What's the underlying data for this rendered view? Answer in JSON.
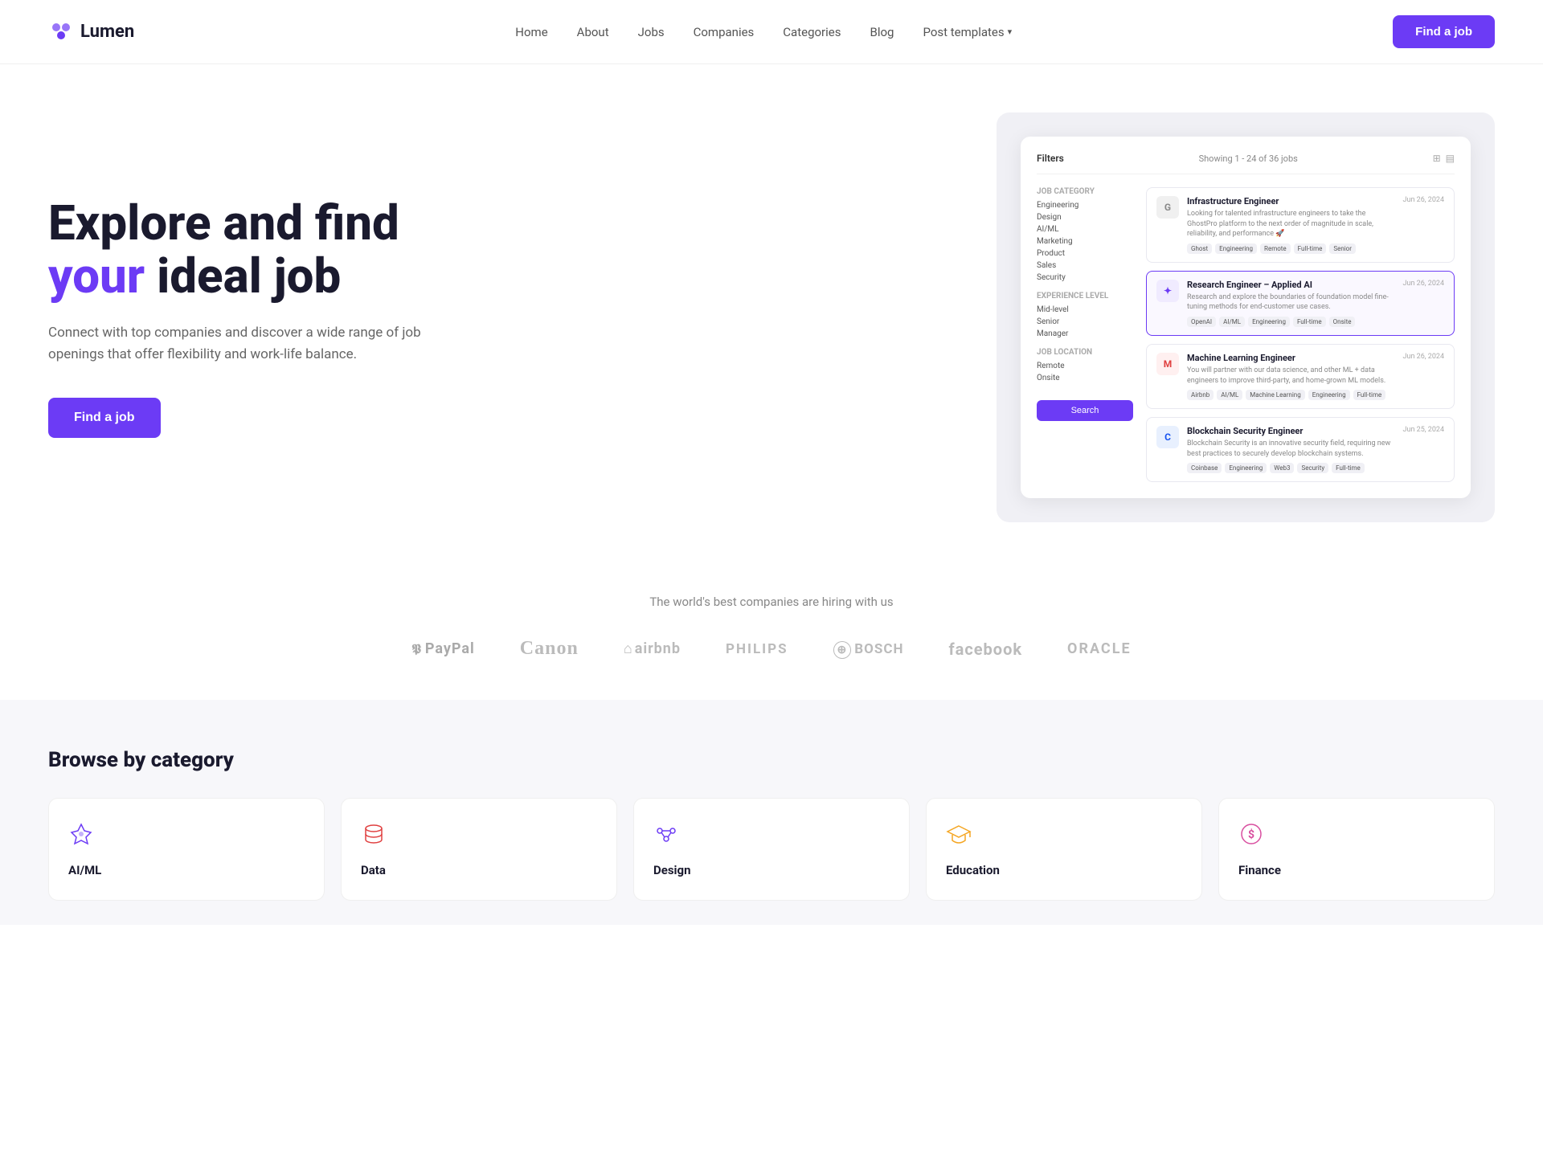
{
  "navbar": {
    "logo_text": "Lumen",
    "nav_items": [
      {
        "label": "Home",
        "id": "home"
      },
      {
        "label": "About",
        "id": "about"
      },
      {
        "label": "Jobs",
        "id": "jobs"
      },
      {
        "label": "Companies",
        "id": "companies"
      },
      {
        "label": "Categories",
        "id": "categories"
      },
      {
        "label": "Blog",
        "id": "blog"
      },
      {
        "label": "Post templates",
        "id": "post-templates",
        "has_dropdown": true
      }
    ],
    "cta_label": "Find a job"
  },
  "hero": {
    "title_line1": "Explore and find",
    "title_highlight": "your",
    "title_line2": "ideal job",
    "subtitle": "Connect with top companies and discover a wide range of job openings that offer flexibility and work-life balance.",
    "cta_label": "Find a job"
  },
  "mock_ui": {
    "filters_label": "Filters",
    "showing_text": "Showing 1 - 24 of 36 jobs",
    "sidebar": {
      "sections": [
        {
          "title": "Job category",
          "items": [
            "Engineering",
            "Design",
            "AI/ML",
            "Marketing",
            "Product",
            "Sales",
            "Security"
          ]
        },
        {
          "title": "Experience Level",
          "items": [
            "Mid-level",
            "Senior",
            "Manager"
          ]
        },
        {
          "title": "Job location",
          "items": [
            "Remote",
            "Onsite"
          ]
        }
      ],
      "search_btn": "Search"
    },
    "jobs": [
      {
        "title": "Infrastructure Engineer",
        "logo": "G",
        "logo_color": "#888",
        "date": "Jun 26, 2024",
        "description": "Looking for talented infrastructure engineers to take the GhostPro platform to the next order of magnitude in scale, reliability, and performance 🚀",
        "tags": [
          "Ghost",
          "Engineering",
          "Remote",
          "Full-time",
          "Senior"
        ],
        "selected": false
      },
      {
        "title": "Research Engineer – Applied AI",
        "logo": "✦",
        "logo_color": "#6c3bf5",
        "date": "Jun 26, 2024",
        "description": "Research and explore the boundaries of foundation model fine-tuning methods for end-customer use cases.",
        "tags": [
          "OpenAI",
          "AI/ML",
          "Engineering",
          "Full-time",
          "Onsite"
        ],
        "selected": true
      },
      {
        "title": "Machine Learning Engineer",
        "logo": "M",
        "logo_color": "#e04040",
        "date": "Jun 26, 2024",
        "description": "You will partner with our data science, and other ML + data engineers to improve third-party, and home-grown ML models.",
        "tags": [
          "Airbnb",
          "AI/ML",
          "Machine Learning",
          "Engineering",
          "Full-time"
        ],
        "selected": false
      },
      {
        "title": "Blockchain Security Engineer",
        "logo": "C",
        "logo_color": "#1652f0",
        "date": "Jun 25, 2024",
        "description": "Blockchain Security is an innovative security field, requiring new best practices to securely develop blockchain systems.",
        "tags": [
          "Coinbase",
          "Engineering",
          "Web3",
          "Security",
          "Full-time"
        ],
        "selected": false
      }
    ]
  },
  "brands": {
    "subtitle": "The world's best companies are hiring with us",
    "items": [
      {
        "name": "PayPal",
        "class": "paypal"
      },
      {
        "name": "Canon",
        "class": "canon"
      },
      {
        "name": "airbnb",
        "class": "airbnb"
      },
      {
        "name": "PHILIPS",
        "class": "philips"
      },
      {
        "name": "BOSCH",
        "class": "bosch"
      },
      {
        "name": "facebook",
        "class": "facebook"
      },
      {
        "name": "ORACLE",
        "class": "oracle"
      }
    ]
  },
  "categories": {
    "title": "Browse by category",
    "items": [
      {
        "name": "AI/ML",
        "icon": "✦",
        "icon_class": "icon-aiml",
        "count": ""
      },
      {
        "name": "Data",
        "icon": "🗄",
        "icon_class": "icon-data",
        "count": ""
      },
      {
        "name": "Design",
        "icon": "◇",
        "icon_class": "icon-design",
        "count": ""
      },
      {
        "name": "Education",
        "icon": "🎓",
        "icon_class": "icon-education",
        "count": ""
      },
      {
        "name": "Finance",
        "icon": "$",
        "icon_class": "icon-finance",
        "count": ""
      }
    ]
  }
}
